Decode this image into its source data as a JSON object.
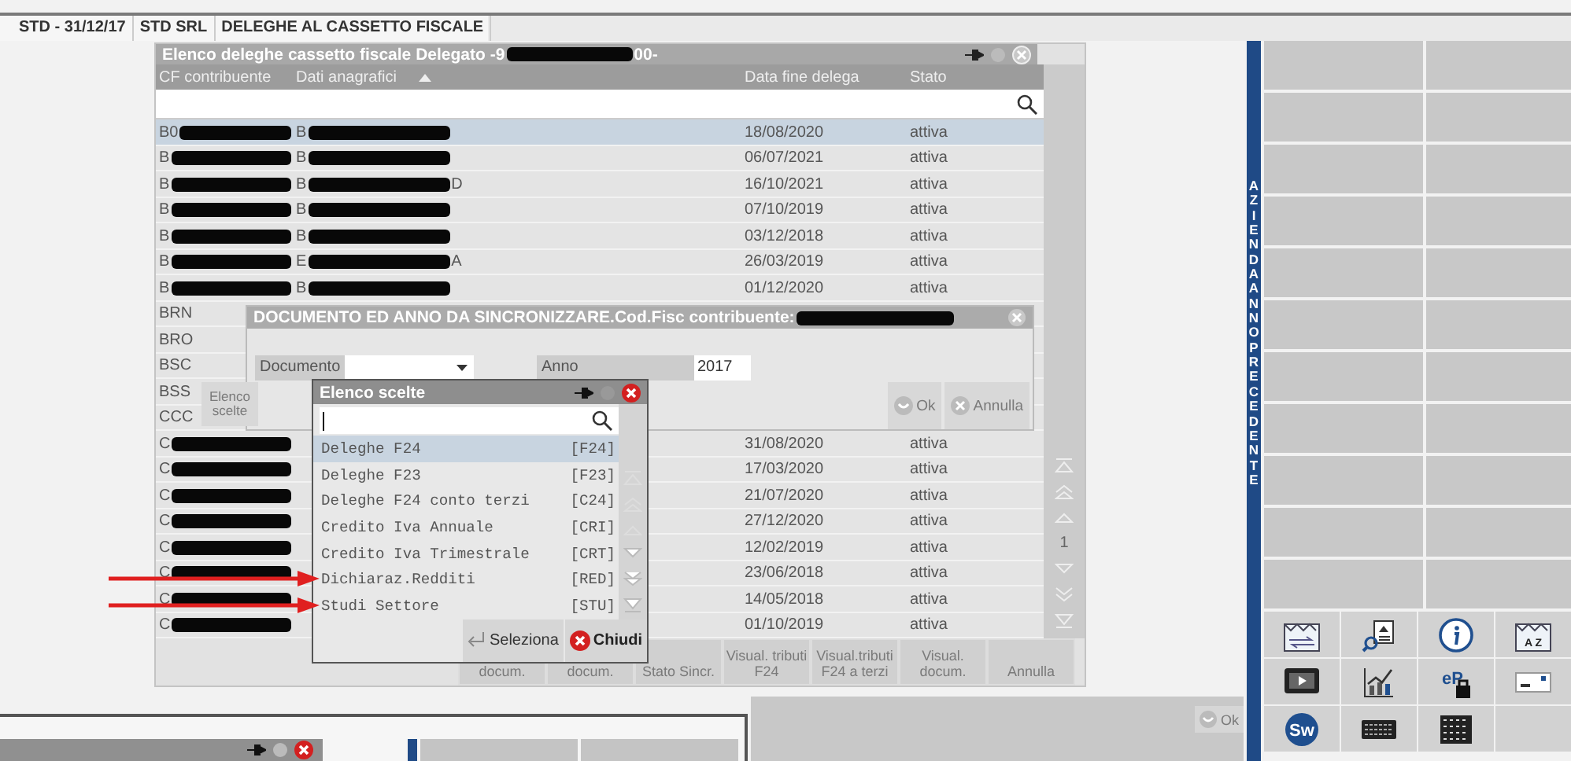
{
  "header": {
    "segments": [
      "STD - 31/12/17",
      "STD SRL",
      "DELEGHE AL CASSETTO FISCALE"
    ]
  },
  "list_window": {
    "title": "Elenco deleghe cassetto fiscale Delegato -9",
    "title_end": "00-",
    "title_redacted": true,
    "columns": [
      {
        "label": "CF contribuente",
        "sorted": false
      },
      {
        "label": "Dati anagrafici",
        "sorted": true
      },
      {
        "label": "Data fine delega",
        "sorted": false
      },
      {
        "label": "Stato",
        "sorted": false
      }
    ],
    "rows": [
      {
        "cf": "B0",
        "name": "B",
        "date": "18/08/2020",
        "status": "attiva",
        "selected": true,
        "redacted": true
      },
      {
        "cf": "B",
        "name": "B",
        "date": "06/07/2021",
        "status": "attiva",
        "selected": false,
        "redacted": true
      },
      {
        "cf": "B",
        "name": "B",
        "name_end": "D",
        "date": "16/10/2021",
        "status": "attiva",
        "selected": false,
        "redacted": true
      },
      {
        "cf": "B",
        "name": "B",
        "date": "07/10/2019",
        "status": "attiva",
        "selected": false,
        "redacted": true
      },
      {
        "cf": "B",
        "name": "B",
        "date": "03/12/2018",
        "status": "attiva",
        "selected": false,
        "redacted": true
      },
      {
        "cf": "B",
        "name": "E",
        "name_end": "A",
        "date": "26/03/2019",
        "status": "attiva",
        "selected": false,
        "redacted": true
      },
      {
        "cf": "B",
        "name": "B",
        "date": "01/12/2020",
        "status": "attiva",
        "selected": false,
        "redacted": true
      },
      {
        "cf": "BRN",
        "selected": false,
        "redacted": false
      },
      {
        "cf": "BRO",
        "selected": false,
        "redacted": false
      },
      {
        "cf": "BSC",
        "selected": false,
        "redacted": false
      },
      {
        "cf": "BSS",
        "selected": false,
        "redacted": false
      },
      {
        "cf": "CCC",
        "selected": false,
        "redacted": false
      },
      {
        "cf": "C",
        "date": "31/08/2020",
        "status": "attiva",
        "selected": false,
        "redacted": true
      },
      {
        "cf": "C",
        "date": "17/03/2020",
        "status": "attiva",
        "selected": false,
        "redacted": true
      },
      {
        "cf": "C",
        "date": "21/07/2020",
        "status": "attiva",
        "selected": false,
        "redacted": true
      },
      {
        "cf": "C",
        "date": "27/12/2020",
        "status": "attiva",
        "selected": false,
        "redacted": true
      },
      {
        "cf": "C",
        "date": "12/02/2019",
        "status": "attiva",
        "selected": false,
        "redacted": true
      },
      {
        "cf": "C",
        "date": "23/06/2018",
        "status": "attiva",
        "selected": false,
        "redacted": true
      },
      {
        "cf": "C",
        "date": "14/05/2018",
        "status": "attiva",
        "selected": false,
        "redacted": true
      },
      {
        "cf": "C",
        "date": "01/10/2019",
        "status": "attiva",
        "selected": false,
        "redacted": true
      }
    ],
    "scroll_page": "1",
    "toolbar": [
      {
        "label": "docum.",
        "disabled": true
      },
      {
        "label": "docum.",
        "disabled": true
      },
      {
        "label": "Stato Sincr.",
        "disabled": true
      },
      {
        "label": "Visual. tributi F24",
        "disabled": true
      },
      {
        "label": "Visual.tributi F24 a terzi",
        "disabled": true
      },
      {
        "label": "Visual. docum.",
        "disabled": true
      },
      {
        "label": "Annulla",
        "disabled": true
      }
    ],
    "side_button": {
      "label": "Elenco scelte",
      "disabled": true
    }
  },
  "sync_dialog": {
    "title": "DOCUMENTO ED ANNO DA SINCRONIZZARE.Cod.Fisc contribuente:",
    "title_redacted": true,
    "fields": [
      {
        "kind": "dropdown",
        "label": "Documento"
      },
      {
        "kind": "text",
        "label": "Anno",
        "value": "2017"
      }
    ],
    "buttons": [
      {
        "kind": "ok",
        "label": "Ok",
        "disabled": true
      },
      {
        "kind": "cancel",
        "label": "Annulla",
        "disabled": true
      }
    ]
  },
  "choice_popup": {
    "title": "Elenco scelte",
    "items": [
      {
        "label": "Deleghe F24",
        "code": "[F24]",
        "selected": true,
        "marked": false
      },
      {
        "label": "Deleghe F23",
        "code": "[F23]",
        "selected": false,
        "marked": false
      },
      {
        "label": "Deleghe F24 conto terzi",
        "code": "[C24]",
        "selected": false,
        "marked": false
      },
      {
        "label": "Credito Iva Annuale",
        "code": "[CRI]",
        "selected": false,
        "marked": false
      },
      {
        "label": "Credito Iva Trimestrale",
        "code": "[CRT]",
        "selected": false,
        "marked": false
      },
      {
        "label": "Dichiaraz.Redditi",
        "code": "[RED]",
        "selected": false,
        "marked": true
      },
      {
        "label": "Studi Settore",
        "code": "[STU]",
        "selected": false,
        "marked": true
      }
    ],
    "buttons": [
      {
        "kind": "select",
        "label": "Seleziona"
      },
      {
        "kind": "close",
        "label": "Chiudi"
      }
    ]
  },
  "side_panel": {
    "label": "AZIENDA ANNO PRECEDENTE",
    "icons": [
      {
        "kind": "factory"
      },
      {
        "kind": "search-doc"
      },
      {
        "kind": "info"
      },
      {
        "kind": "factory",
        "text": "A Z"
      },
      {
        "kind": "video"
      },
      {
        "kind": "chart"
      },
      {
        "kind": "lock",
        "text": "eP"
      },
      {
        "kind": "card"
      },
      {
        "kind": "badge",
        "text": "Sw"
      },
      {
        "kind": "keyboard"
      },
      {
        "kind": "grid"
      }
    ]
  },
  "footer": {
    "ok_label": "Ok",
    "ok_disabled": true
  }
}
